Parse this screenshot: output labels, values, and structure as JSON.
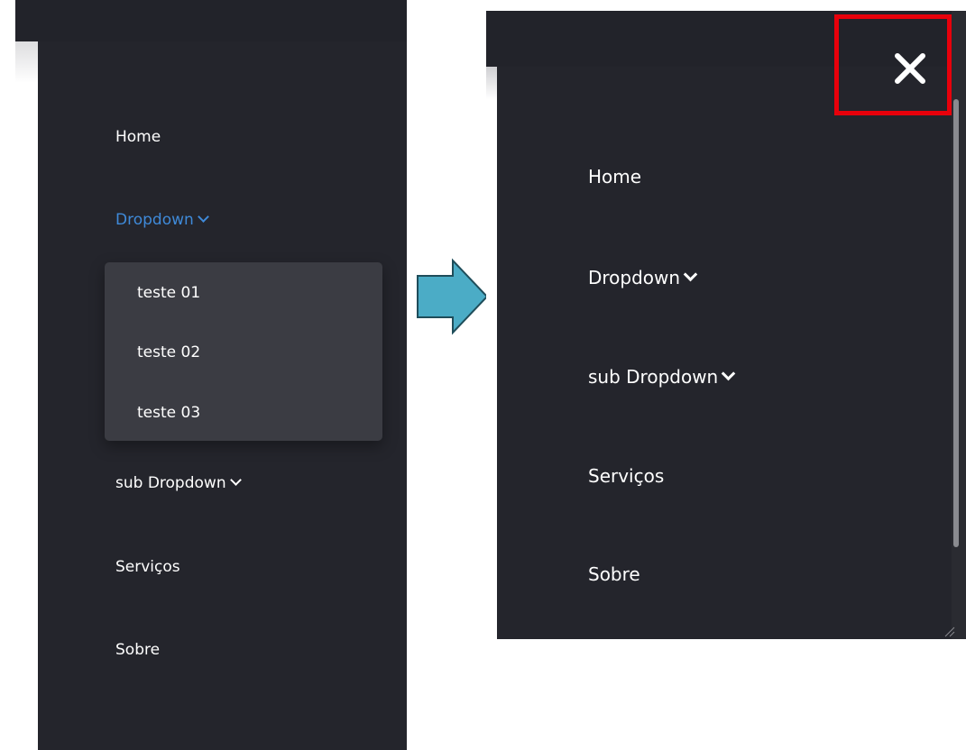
{
  "left_menu": {
    "items": [
      {
        "label": "Home"
      },
      {
        "label": "Dropdown",
        "active": true,
        "has_chevron": true
      },
      {
        "label": "sub Dropdown",
        "has_chevron": true
      },
      {
        "label": "Serviços"
      },
      {
        "label": "Sobre"
      }
    ],
    "submenu": [
      {
        "label": "teste 01"
      },
      {
        "label": "teste 02"
      },
      {
        "label": "teste 03"
      }
    ]
  },
  "right_menu": {
    "close_icon": "close-icon",
    "items": [
      {
        "label": "Home"
      },
      {
        "label": "Dropdown",
        "has_chevron": true
      },
      {
        "label": "sub Dropdown",
        "has_chevron": true
      },
      {
        "label": "Serviços"
      },
      {
        "label": "Sobre"
      }
    ]
  },
  "colors": {
    "panel_bg": "#24252c",
    "submenu_bg": "#3b3c43",
    "active_link": "#3f8ad9",
    "arrow_fill": "#4bacc6",
    "arrow_stroke": "#1f4d5a",
    "highlight_box": "#e8000b"
  }
}
